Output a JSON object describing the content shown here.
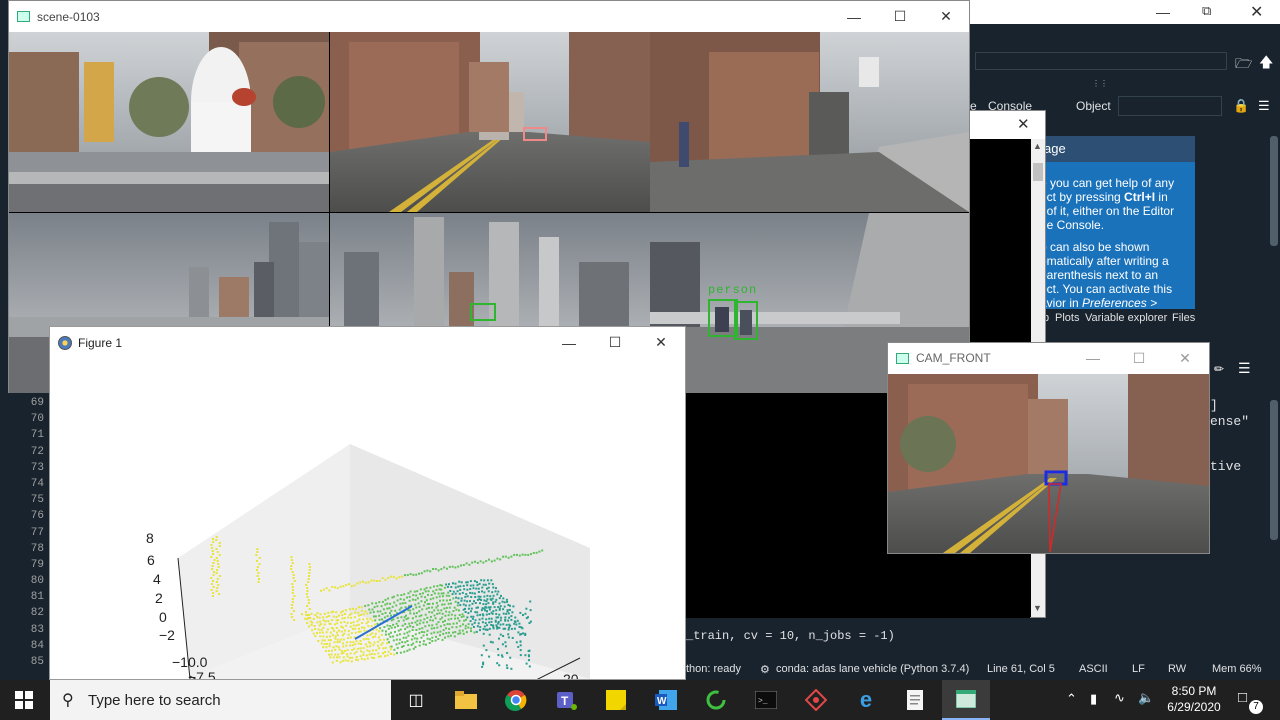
{
  "scene_window": {
    "title": "scene-0103"
  },
  "figure_window": {
    "title": "Figure 1",
    "z_ticks": [
      "8",
      "6",
      "4",
      "2",
      "0",
      "−2"
    ],
    "x_ticks": [
      "−10.0",
      "−7.5"
    ],
    "y_ticks": [
      "20"
    ]
  },
  "cam_window": {
    "title": "CAM_FRONT"
  },
  "detections": {
    "person_label": "person"
  },
  "spyder": {
    "tabs": [
      "Console"
    ],
    "object_label": "Object",
    "help_title": "age",
    "help_text_1": "e you can get help of any",
    "help_text_2": "ect by pressing ",
    "help_text_2b": "Ctrl+I",
    "help_text_2c": " in",
    "help_text_3": "t of it, either on the Editor",
    "help_text_4": "ne Console.",
    "help_text_5": "o can also be shown",
    "help_text_6": "omatically after writing a",
    "help_text_7": "parenthesis next to an",
    "help_text_8": "ect. You can activate this",
    "help_text_9": "avior in ",
    "help_text_9b": "Preferences >",
    "pane_tabs": [
      "p",
      "Plots",
      "Variable explorer",
      "Files"
    ],
    "code_fragments": [
      "]",
      "ense\"",
      "tive"
    ],
    "console_line": "_train, cv = 10, n_jobs = -1)",
    "line_numbers": [
      "69",
      "70",
      "71",
      "72",
      "73",
      "74",
      "75",
      "76",
      "77",
      "78",
      "79",
      "80",
      "81",
      "82",
      "83",
      "84",
      "85"
    ],
    "status": {
      "ready": "thon: ready",
      "conda": "conda: adas lane vehicle (Python 3.7.4)",
      "position": "Line 61, Col 5",
      "encoding": "ASCII",
      "eol": "LF",
      "rw": "RW",
      "mem": "Mem 66%"
    }
  },
  "taskbar": {
    "search_placeholder": "Type here to search",
    "time": "8:50 PM",
    "date": "6/29/2020",
    "notification_count": "7"
  },
  "colors": {
    "spyder_bg": "#19232d",
    "help_blue": "#1a72bb",
    "taskbar": "#202020",
    "lidar_yellow": "#e8e43a",
    "lidar_green": "#62c35a",
    "lidar_teal": "#2a9d8f",
    "detection_green": "#2fb52f",
    "detection_blue": "#1a2de0",
    "detection_pink": "#f08a8a"
  }
}
